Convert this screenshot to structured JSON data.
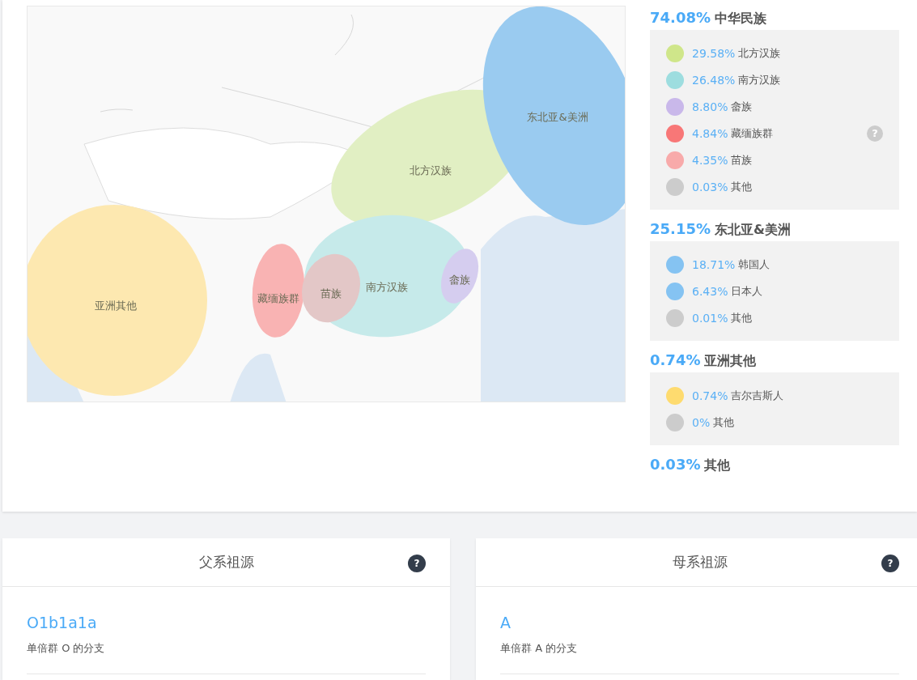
{
  "map": {
    "regions": [
      {
        "label": "亚洲其他",
        "color": "#fde8b0"
      },
      {
        "label": "北方汉族",
        "color": "#e1efc3"
      },
      {
        "label": "南方汉族",
        "color": "#c6eaea"
      },
      {
        "label": "藏缅族群",
        "color": "#f9b3b3"
      },
      {
        "label": "苗族",
        "color": "#e3c7c7"
      },
      {
        "label": "畲族",
        "color": "#d5cdef"
      },
      {
        "label": "东北亚&美洲",
        "color": "#9acbf0"
      }
    ]
  },
  "groups": [
    {
      "percent": "74.08%",
      "name": "中华民族",
      "items": [
        {
          "color": "#cfe68a",
          "percent": "29.58%",
          "name": "北方汉族"
        },
        {
          "color": "#9ddddf",
          "percent": "26.48%",
          "name": "南方汉族"
        },
        {
          "color": "#c9b8ea",
          "percent": "8.80%",
          "name": "畲族"
        },
        {
          "color": "#f87777",
          "percent": "4.84%",
          "name": "藏缅族群",
          "help_mark": "?"
        },
        {
          "color": "#f8aaaa",
          "percent": "4.35%",
          "name": "苗族"
        },
        {
          "color": "#cccccc",
          "percent": "0.03%",
          "name": "其他"
        }
      ]
    },
    {
      "percent": "25.15%",
      "name": "东北亚&美洲",
      "items": [
        {
          "color": "#85c3f2",
          "percent": "18.71%",
          "name": "韩国人"
        },
        {
          "color": "#85c3f2",
          "percent": "6.43%",
          "name": "日本人"
        },
        {
          "color": "#cccccc",
          "percent": "0.01%",
          "name": "其他"
        }
      ]
    },
    {
      "percent": "0.74%",
      "name": "亚洲其他",
      "items": [
        {
          "color": "#fedb6f",
          "percent": "0.74%",
          "name": "吉尔吉斯人"
        },
        {
          "color": "#cccccc",
          "percent": "0%",
          "name": "其他"
        }
      ]
    },
    {
      "percent": "0.03%",
      "name": "其他"
    }
  ],
  "lineages": [
    {
      "title": "父系祖源",
      "help_mark": "?",
      "haplogroup": "O1b1a1a",
      "description": "单倍群 O 的分支"
    },
    {
      "title": "母系祖源",
      "help_mark": "?",
      "haplogroup": "A",
      "description": "单倍群 A 的分支"
    }
  ]
}
